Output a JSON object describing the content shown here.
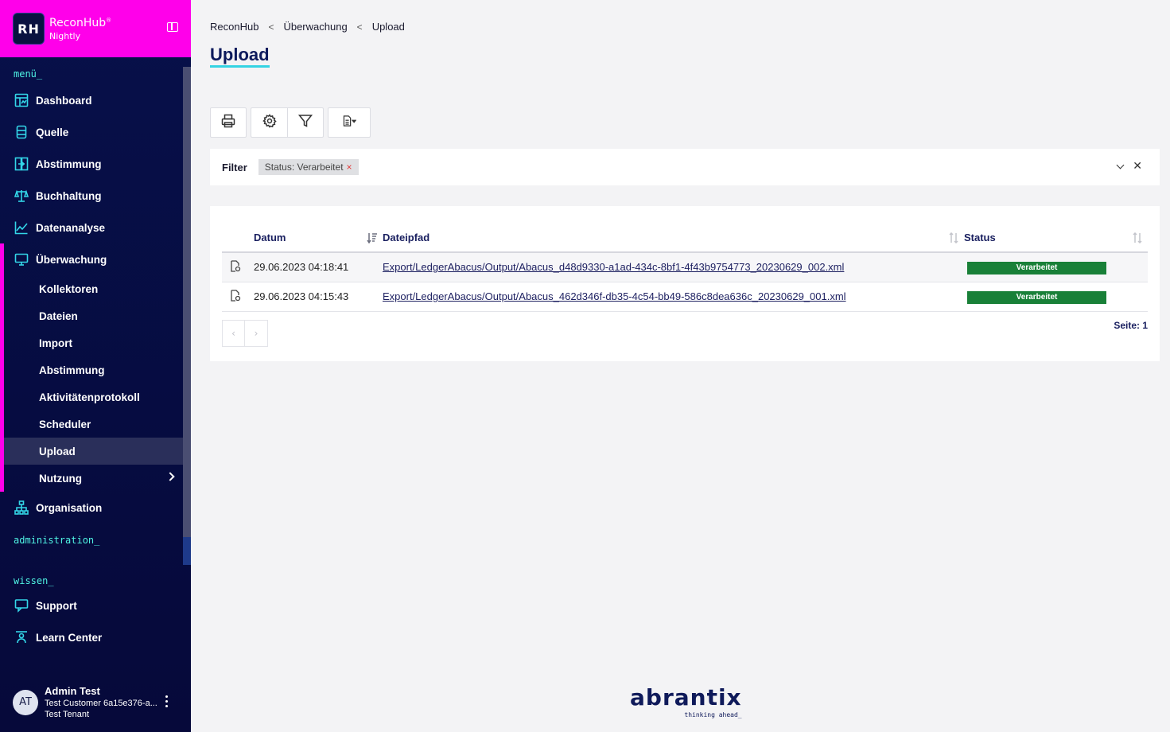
{
  "brand": {
    "logo": "RH",
    "name": "ReconHub",
    "trademark": "®",
    "edition": "Nightly",
    "color": "#ff00ea"
  },
  "sidebar": {
    "menu_label": "menü_",
    "items": [
      {
        "label": "Dashboard",
        "icon": "dashboard-icon"
      },
      {
        "label": "Quelle",
        "icon": "database-icon"
      },
      {
        "label": "Abstimmung",
        "icon": "reconcile-icon"
      },
      {
        "label": "Buchhaltung",
        "icon": "scale-icon"
      },
      {
        "label": "Datenanalyse",
        "icon": "chart-line-icon"
      },
      {
        "label": "Überwachung",
        "icon": "monitor-icon"
      }
    ],
    "sub_items": [
      {
        "label": "Kollektoren"
      },
      {
        "label": "Dateien"
      },
      {
        "label": "Import"
      },
      {
        "label": "Abstimmung"
      },
      {
        "label": "Aktivitätenprotokoll"
      },
      {
        "label": "Scheduler"
      },
      {
        "label": "Upload",
        "active": true
      },
      {
        "label": "Nutzung"
      }
    ],
    "organisation": "Organisation",
    "admin_label": "administration_",
    "wissen_label": "wissen_",
    "support": "Support",
    "learn_center": "Learn Center"
  },
  "user": {
    "initials": "AT",
    "name": "Admin Test",
    "customer": "Test Customer 6a15e376-a...",
    "tenant": "Test Tenant"
  },
  "breadcrumb": [
    "ReconHub",
    "Überwachung",
    "Upload"
  ],
  "page_title": "Upload",
  "toolbar": {
    "icons": [
      "print-icon",
      "settings-icon",
      "filter-icon",
      "export-document-icon"
    ]
  },
  "filter": {
    "label": "Filter",
    "tag": "Status: Verarbeitet",
    "tag_remove": "×"
  },
  "table": {
    "columns": [
      "Datum",
      "Dateipfad",
      "Status"
    ],
    "rows": [
      {
        "datum": "29.06.2023 04:18:41",
        "pfad": "Export/LedgerAbacus/Output/Abacus_d48d9330-a1ad-434c-8bf1-4f43b9754773_20230629_002.xml",
        "status": "Verarbeitet"
      },
      {
        "datum": "29.06.2023 04:15:43",
        "pfad": "Export/LedgerAbacus/Output/Abacus_462d346f-db35-4c54-bb49-586c8dea636c_20230629_001.xml",
        "status": "Verarbeitet"
      }
    ],
    "status_color": "#198038"
  },
  "pagination": {
    "prev": "‹",
    "next": "›",
    "page_info": "Seite: 1"
  },
  "footer": {
    "logo_name": "abrantix",
    "logo_tagline": "thinking ahead_"
  }
}
